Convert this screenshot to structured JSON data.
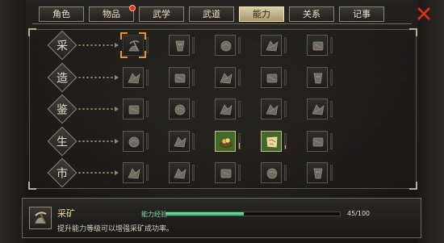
{
  "tabs": [
    {
      "label": "角色",
      "active": false,
      "badge": false
    },
    {
      "label": "物品",
      "active": false,
      "badge": true
    },
    {
      "label": "武学",
      "active": false,
      "badge": false
    },
    {
      "label": "武道",
      "active": false,
      "badge": false
    },
    {
      "label": "能力",
      "active": true,
      "badge": false
    },
    {
      "label": "关系",
      "active": false,
      "badge": false
    },
    {
      "label": "记事",
      "active": false,
      "badge": false
    }
  ],
  "close_icon": "close-x-icon",
  "rows": [
    {
      "label": "采",
      "slots": [
        {
          "icon": "pickaxe-ore-icon",
          "unlocked": false,
          "selected": true,
          "level": 0
        },
        {
          "icon": "herb-sickle-icon",
          "unlocked": false,
          "selected": false,
          "level": 0
        },
        {
          "icon": "fishing-basket-icon",
          "unlocked": false,
          "selected": false,
          "level": 0
        },
        {
          "icon": "axe-wood-icon",
          "unlocked": false,
          "selected": false,
          "level": 0
        },
        {
          "icon": "silkworm-jar-icon",
          "unlocked": false,
          "selected": false,
          "level": 0
        }
      ]
    },
    {
      "label": "造",
      "slots": [
        {
          "icon": "forge-hammer-icon",
          "unlocked": false,
          "selected": false,
          "level": 0
        },
        {
          "icon": "armor-craft-icon",
          "unlocked": false,
          "selected": false,
          "level": 0
        },
        {
          "icon": "alchemy-furnace-icon",
          "unlocked": false,
          "selected": false,
          "level": 0
        },
        {
          "icon": "cooking-pot-icon",
          "unlocked": false,
          "selected": false,
          "level": 0
        },
        {
          "icon": "tailoring-icon",
          "unlocked": false,
          "selected": false,
          "level": 0
        }
      ]
    },
    {
      "label": "鉴",
      "slots": [
        {
          "icon": "appraise-weapon-icon",
          "unlocked": false,
          "selected": false,
          "level": 0
        },
        {
          "icon": "appraise-armor-icon",
          "unlocked": false,
          "selected": false,
          "level": 0
        },
        {
          "icon": "appraise-medicine-icon",
          "unlocked": false,
          "selected": false,
          "level": 0
        },
        {
          "icon": "appraise-food-icon",
          "unlocked": false,
          "selected": false,
          "level": 0
        },
        {
          "icon": "appraise-cloth-icon",
          "unlocked": false,
          "selected": false,
          "level": 0
        }
      ]
    },
    {
      "label": "生",
      "slots": [
        {
          "icon": "cup-vessel-icon",
          "unlocked": false,
          "selected": false,
          "level": 0
        },
        {
          "icon": "scroll-writing-icon",
          "unlocked": false,
          "selected": false,
          "level": 0
        },
        {
          "icon": "gold-coin-bowl-icon",
          "unlocked": true,
          "selected": false,
          "level": 0.4
        },
        {
          "icon": "parchment-map-icon",
          "unlocked": true,
          "selected": false,
          "level": 0.2
        },
        {
          "icon": "rope-coil-icon",
          "unlocked": false,
          "selected": false,
          "level": 0
        }
      ]
    },
    {
      "label": "市",
      "slots": [
        {
          "icon": "hand-bargain-icon",
          "unlocked": false,
          "selected": false,
          "level": 0
        },
        {
          "icon": "sword-trade-icon",
          "unlocked": false,
          "selected": false,
          "level": 0
        },
        {
          "icon": "money-pouch-icon",
          "unlocked": false,
          "selected": false,
          "level": 0
        },
        {
          "icon": "gear-lotus-icon",
          "unlocked": false,
          "selected": false,
          "level": 0
        },
        {
          "icon": "rare-goods-icon",
          "unlocked": false,
          "selected": false,
          "level": 0
        }
      ]
    }
  ],
  "info": {
    "icon": "pickaxe-ore-icon",
    "name": "采矿",
    "description": "提升能力等级可以增强采矿成功率。",
    "exp_label": "能力经验",
    "exp_current": 45,
    "exp_max": 100,
    "exp_text": "45/100"
  },
  "colors": {
    "active_tab": "#d8cda6",
    "exp_bar": "#5fe2a8",
    "selection": "#e79a2a",
    "badge": "#e0341f",
    "close": "#e0341f"
  }
}
